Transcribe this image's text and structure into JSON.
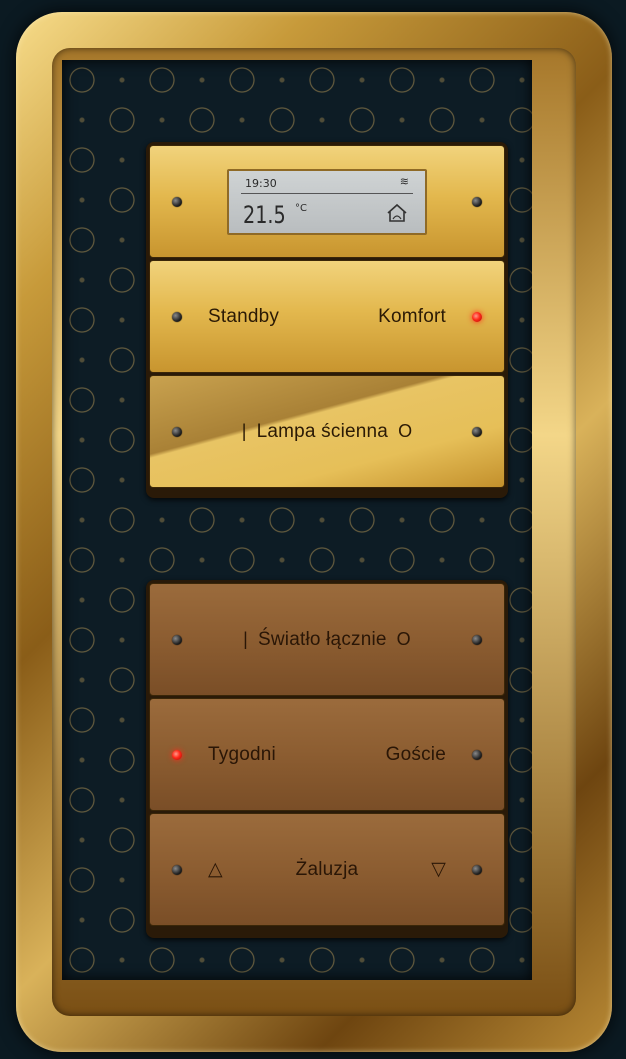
{
  "display": {
    "time": "19:30",
    "temperature": "21.5",
    "unit": "°C",
    "heating_indicator": "≋"
  },
  "buttons": {
    "left_label": "Standby",
    "right_label": "Komfort",
    "lamp_on_symbol": "|",
    "lamp_label": "Lampa ścienna",
    "lamp_off_symbol": "O",
    "light_on_symbol": "|",
    "light_label": "Światło łącznie",
    "light_off_symbol": "O",
    "week_label": "Tygodni",
    "guests_label": "Goście",
    "blind_up_symbol": "△",
    "blind_label": "Żaluzja",
    "blind_down_symbol": "▽"
  },
  "icons": {
    "house": "house-icon",
    "led": "led-indicator-icon"
  },
  "colors": {
    "gold": "#e3b84e",
    "bronze": "#8c5d31",
    "led_active": "#ff2a1a",
    "plate": "#0d1c25"
  }
}
